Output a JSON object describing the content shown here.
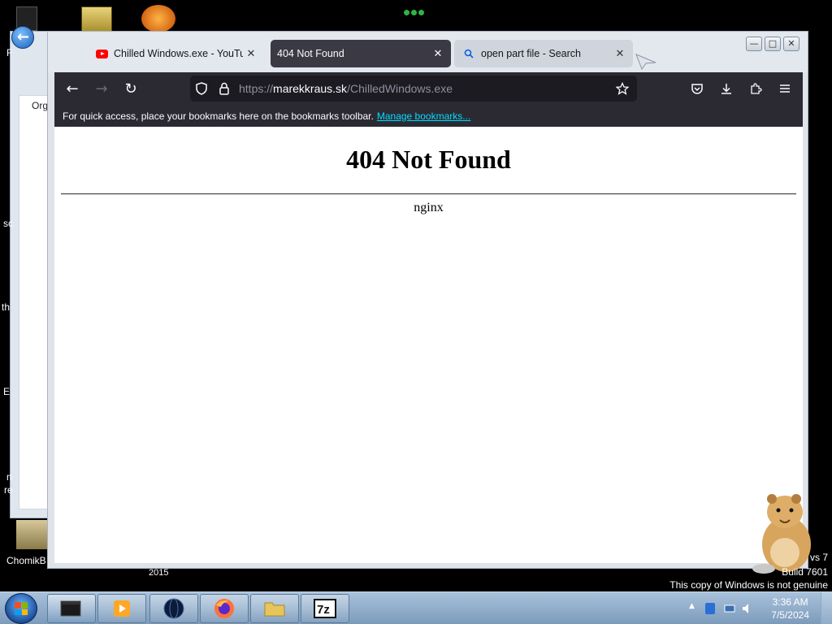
{
  "desktop": {
    "left_text_fragments": [
      "F",
      "sc",
      "th",
      "E",
      "n",
      "re"
    ],
    "bg_window_label": "Org",
    "desktop_icon_label": "ChomikB",
    "year_label": "2015",
    "watermark": {
      "line1": "vs 7",
      "line2": "Build 7601",
      "line3": "This copy of Windows is not genuine"
    }
  },
  "browser": {
    "tabs": [
      {
        "title": "Chilled Windows.exe - YouTube",
        "icon": "youtube-icon",
        "active": false
      },
      {
        "title": "404 Not Found",
        "icon": "none",
        "active": true
      },
      {
        "title": "open part file - Search",
        "icon": "search-icon",
        "active": false
      }
    ],
    "window_controls": {
      "minimize": "—",
      "maximize": "□",
      "close": "✕"
    },
    "toolbar": {
      "back": "←",
      "forward": "→",
      "reload": "↻",
      "url_prefix": "https://",
      "url_host": "marekkraus.sk",
      "url_path": "/ChilledWindows.exe"
    },
    "bookmarks_bar": {
      "message": "For quick access, place your bookmarks here on the bookmarks toolbar.",
      "link": "Manage bookmarks..."
    }
  },
  "page": {
    "heading": "404 Not Found",
    "server": "nginx"
  },
  "taskbar": {
    "clock_time": "3:36 AM",
    "clock_date": "7/5/2024",
    "tray_arrow": "▲"
  }
}
